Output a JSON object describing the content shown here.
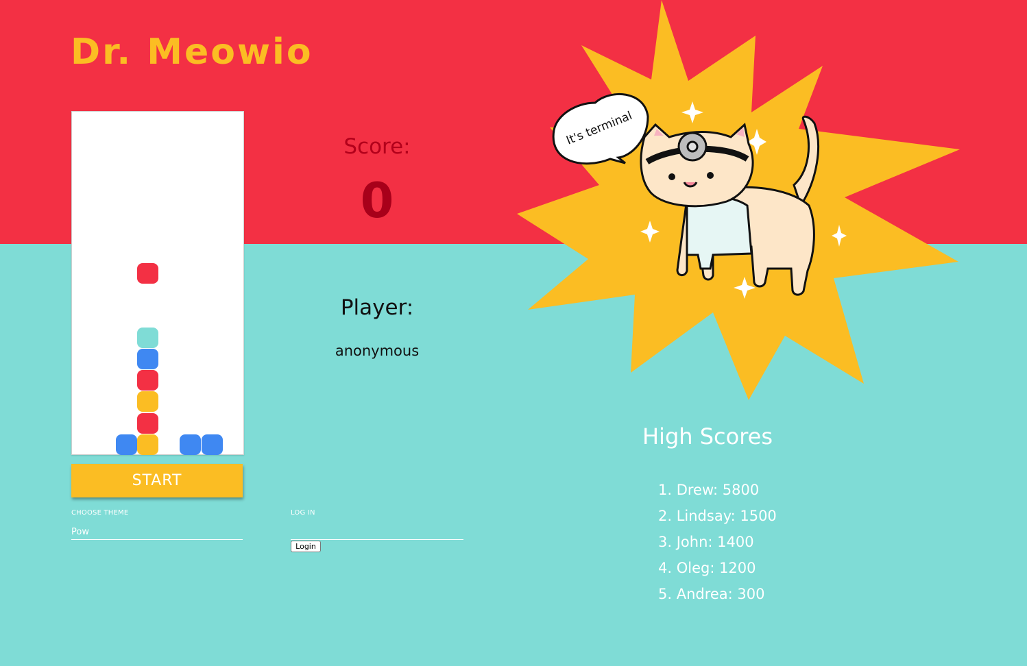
{
  "app": {
    "title": "Dr. Meowio"
  },
  "colors": {
    "top_band": "#f33044",
    "bottom_band": "#7fdcd6",
    "accent_yellow": "#fbbd23",
    "pill_red": "#f33044",
    "pill_yellow": "#fbbd23",
    "pill_blue": "#3f88f2",
    "pill_teal": "#7fdcd6"
  },
  "board": {
    "columns": 8,
    "rows": 16,
    "pieces": [
      {
        "col": 3,
        "row": 7,
        "color": "red"
      },
      {
        "col": 3,
        "row": 10,
        "color": "teal"
      },
      {
        "col": 3,
        "row": 11,
        "color": "blue"
      },
      {
        "col": 3,
        "row": 12,
        "color": "red"
      },
      {
        "col": 3,
        "row": 13,
        "color": "yellow"
      },
      {
        "col": 3,
        "row": 14,
        "color": "red"
      },
      {
        "col": 2,
        "row": 15,
        "color": "blue"
      },
      {
        "col": 3,
        "row": 15,
        "color": "yellow"
      },
      {
        "col": 5,
        "row": 15,
        "color": "blue"
      },
      {
        "col": 6,
        "row": 15,
        "color": "blue"
      }
    ]
  },
  "controls": {
    "start_label": "START",
    "theme_label": "CHOOSE THEME",
    "theme_value": "Pow",
    "login_label": "LOG IN",
    "login_input_value": "",
    "login_button": "Login"
  },
  "score": {
    "label": "Score:",
    "value": "0"
  },
  "player": {
    "label": "Player:",
    "name": "anonymous"
  },
  "mascot": {
    "speech": "It's terminal",
    "icon": "doctor-cat-illustration"
  },
  "high_scores": {
    "title": "High Scores",
    "entries": [
      "1. Drew: 5800",
      "2. Lindsay: 1500",
      "3. John: 1400",
      "4. Oleg: 1200",
      "5. Andrea: 300"
    ]
  }
}
